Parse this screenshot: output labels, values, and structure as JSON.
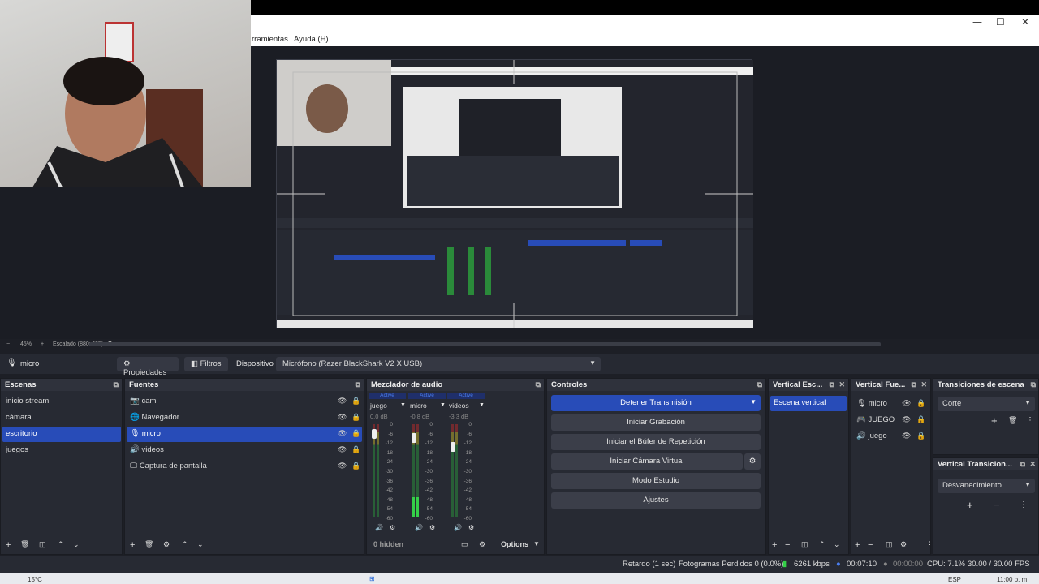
{
  "window": {
    "menu_partial": "rramientas",
    "menu_help": "Ayuda (H)",
    "controls": [
      "—",
      "☐",
      "✕"
    ]
  },
  "zoom": {
    "level": "45%",
    "scaling": "Escalado (880x495)"
  },
  "context_bar": {
    "source_name": "micro",
    "properties_label": "Propiedades",
    "filters_label": "Filtros",
    "device_label": "Dispositivo",
    "device_value": "Micrófono (Razer BlackShark V2 X USB)"
  },
  "scenes": {
    "title": "Escenas",
    "items": [
      {
        "label": "inicio stream",
        "selected": false
      },
      {
        "label": "cámara",
        "selected": false
      },
      {
        "label": "escritorio",
        "selected": true
      },
      {
        "label": "juegos",
        "selected": false
      }
    ]
  },
  "sources": {
    "title": "Fuentes",
    "items": [
      {
        "label": "cam",
        "icon": "camera-icon",
        "selected": false
      },
      {
        "label": "Navegador",
        "icon": "globe-icon",
        "selected": false
      },
      {
        "label": "micro",
        "icon": "microphone-icon",
        "selected": true
      },
      {
        "label": "videos",
        "icon": "speaker-icon",
        "selected": false
      },
      {
        "label": "Captura de pantalla",
        "icon": "monitor-icon",
        "selected": false
      }
    ]
  },
  "mixer": {
    "title": "Mezclador de audio",
    "channels": [
      {
        "active": "Active",
        "name": "juego",
        "db": "0.0 dB",
        "fader": 0.95,
        "level": 0.0
      },
      {
        "active": "Active",
        "name": "micro",
        "db": "-0.8 dB",
        "fader": 0.9,
        "level": 0.22
      },
      {
        "active": "Active",
        "name": "videos",
        "db": "-3.3 dB",
        "fader": 0.8,
        "level": 0.0
      }
    ],
    "scale": [
      "0",
      "-6",
      "-12",
      "-18",
      "-24",
      "-30",
      "-36",
      "-42",
      "-48",
      "-54",
      "-60"
    ],
    "hidden_label": "0 hidden",
    "options_label": "Options"
  },
  "controls": {
    "title": "Controles",
    "buttons": [
      "Detener Transmisión",
      "Iniciar Grabación",
      "Iniciar el Búfer de Repetición",
      "Iniciar Cámara Virtual",
      "Modo Estudio",
      "Ajustes"
    ]
  },
  "vertical_scenes": {
    "title": "Vertical Esc...",
    "items": [
      "Escena vertical"
    ]
  },
  "vertical_sources": {
    "title": "Vertical Fue...",
    "items": [
      {
        "label": "micro",
        "icon": "microphone-icon"
      },
      {
        "label": "JUEGO",
        "icon": "gamepad-icon"
      },
      {
        "label": "juego",
        "icon": "speaker-icon"
      }
    ]
  },
  "transitions": {
    "title": "Transiciones de escena",
    "value": "Corte"
  },
  "vertical_transitions": {
    "title": "Vertical Transicion...",
    "value": "Desvanecimiento"
  },
  "status": {
    "delay": "Retardo (1 sec)",
    "dropped": "Fotogramas Perdidos 0 (0.0%)",
    "bitrate": "6261 kbps",
    "stream_time": "00:07:10",
    "rec_time": "00:00:00",
    "cpu": "CPU: 7.1%",
    "fps": "30.00 / 30.00 FPS"
  },
  "taskbar": {
    "temp": "15°C",
    "lang": "ESP",
    "time": "11:00 p. m."
  },
  "colors": {
    "accent": "#284cb8",
    "panel": "#272a33",
    "background": "#1d1f26"
  }
}
